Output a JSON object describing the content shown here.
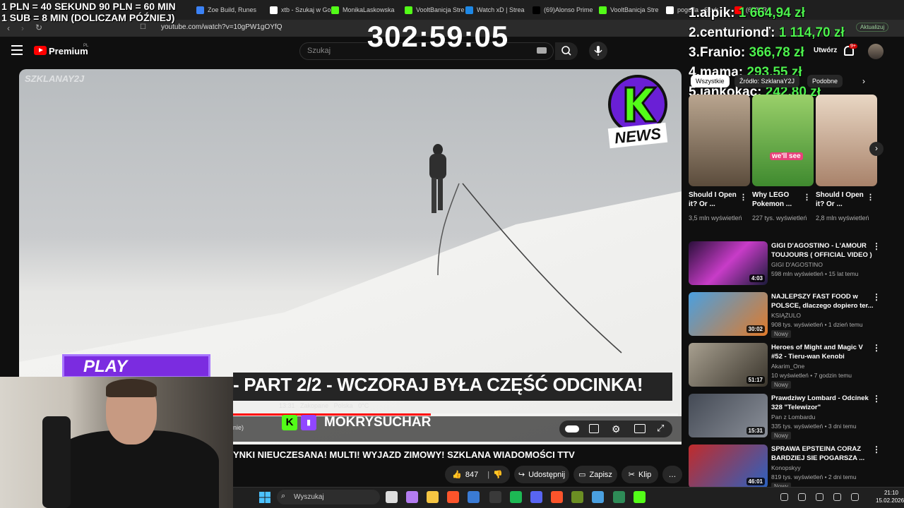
{
  "overlay": {
    "line1": "1 PLN =  40 SEKUND 90 PLN = 60 MIN",
    "line2": "1 SUB = 8 MIN (DOLICZAM PÓŹNIEJ)",
    "timer": "302:59:05"
  },
  "browser": {
    "tabs": [
      {
        "label": "Zoe Build, Runes",
        "color": "#3b82f6"
      },
      {
        "label": "xtb - Szukaj w Go",
        "color": "#ffffff"
      },
      {
        "label": "MonikaLaskowska",
        "color": "#53fc18"
      },
      {
        "label": "VooltBanicja Stre",
        "color": "#53fc18"
      },
      {
        "label": "Watch xD | Strea",
        "color": "#1e88e5"
      },
      {
        "label": "(69)Alonso Prime",
        "color": "#000000"
      },
      {
        "label": "VooltBanicja Stre",
        "color": "#53fc18"
      },
      {
        "label": "pogoda - Szuk",
        "color": "#ffffff"
      },
      {
        "label": "(658) R",
        "color": "#ff0000"
      }
    ],
    "url": "youtube.com/watch?v=10gPW1gOYfQ",
    "update_label": "Aktualizuj"
  },
  "youtube": {
    "logo_label": "Premium",
    "region": "PL",
    "search_placeholder": "Szukaj",
    "create_label": "Utwórz",
    "notifications": "9+"
  },
  "leaderboard": [
    {
      "rank": "1.",
      "name": "alpik:",
      "amount": "1 664,94 zł"
    },
    {
      "rank": "2.",
      "name": "centurionď:",
      "amount": "1 114,70 zł"
    },
    {
      "rank": "3.",
      "name": "Franio:",
      "amount": "366,78 zł"
    },
    {
      "rank": "4.",
      "name": "mama:",
      "amount": "293,55 zł"
    },
    {
      "rank": "5.",
      "name": "jankokac:",
      "amount": "242,80 zł"
    }
  ],
  "video": {
    "watermark": "SZKLANAY2J",
    "knews": "NEWS",
    "banner": "- PART 2/2 - WCZORAJ BYŁA CZĘŚĆ ODCINKA!",
    "info_time": "13:31",
    "info_place": "Zakopane",
    "info_country": "Polska",
    "info_temp": "0°C",
    "channel_chip": "nie)",
    "streamer": "MOKRYSUCHAR",
    "purple_text": "PLAY"
  },
  "title": "YNKI NIEUCZESANA! MULTI! WYJAZD ZIMOWY! SZKLANA WIADOMOŚCI TTV",
  "actions": {
    "likes": "847",
    "share": "Udostępnij",
    "save": "Zapisz",
    "clip": "Klip"
  },
  "chips": [
    "Wszystkie",
    "Źródło: SzklanaY2J",
    "Podobne"
  ],
  "shorts": [
    {
      "title": "Should I Open it? Or ...",
      "views": "3,5 mln wyświetleń"
    },
    {
      "title": "Why LEGO Pokemon ...",
      "views": "227 tys. wyświetleń"
    },
    {
      "title": "Should I Open it? Or ...",
      "views": "2,8 mln wyświetleń"
    }
  ],
  "shorts_caption": "we'll see",
  "recommendations": [
    {
      "title": "GIGI D'AGOSTINO - L'AMOUR TOUJOURS ( OFFICIAL VIDEO )",
      "channel": "GIGI D'AGOSTINO",
      "meta": "598 mln wyświetleń • 15 lat temu",
      "duration": "4:03",
      "new": ""
    },
    {
      "title": "NAJLEPSZY FAST FOOD w POLSCE, dlaczego dopiero ter...",
      "channel": "KSIĄŻULO",
      "meta": "908 tys. wyświetleń • 1 dzień temu",
      "duration": "30:02",
      "new": "Nowy"
    },
    {
      "title": "Heroes of Might and Magic V #52 - Tieru-wan Kenobi",
      "channel": "Akarim_One",
      "meta": "10 wyświetleń • 7 godzin temu",
      "duration": "51:17",
      "new": "Nowy"
    },
    {
      "title": "Prawdziwy Lombard - Odcinek 328 \"Telewizor\"",
      "channel": "Pan z Lombardu",
      "meta": "335 tys. wyświetleń • 3 dni temu",
      "duration": "15:31",
      "new": "Nowy"
    },
    {
      "title": "SPRAWA EPSTEINA CORAZ BARDZIEJ SIE POGARSZA ...",
      "channel": "Konopskyy",
      "meta": "819 tys. wyświetleń • 2 dni temu",
      "duration": "46:01",
      "new": "Nowy"
    }
  ],
  "taskbar": {
    "search_placeholder": "Wyszukaj",
    "time": "21:10",
    "date": "15.02.2026"
  }
}
